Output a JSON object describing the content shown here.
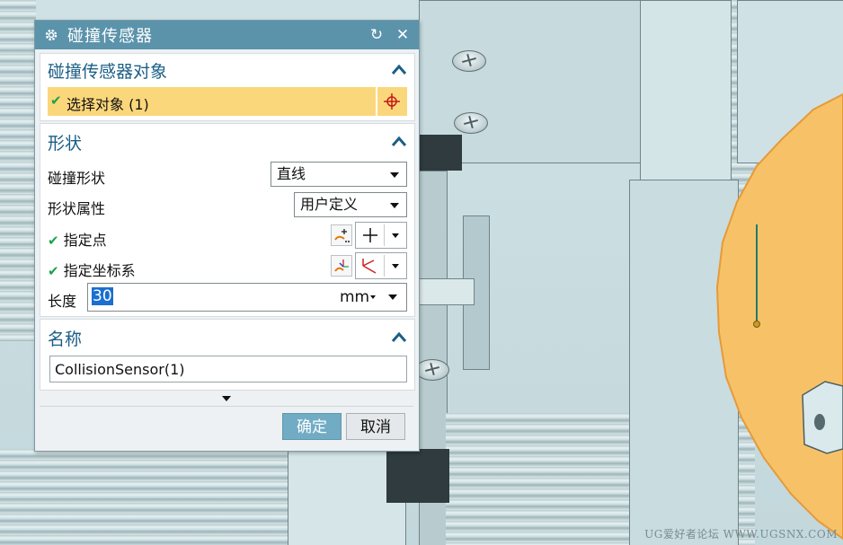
{
  "dialog": {
    "title": "碰撞传感器",
    "reset_icon": "reset-icon",
    "close_icon": "close-icon"
  },
  "object_section": {
    "title": "碰撞传感器对象",
    "select_label": "选择对象 (1)",
    "selected": true
  },
  "shape_section": {
    "title": "形状",
    "collision_shape_label": "碰撞形状",
    "collision_shape_value": "直线",
    "shape_property_label": "形状属性",
    "shape_property_value": "用户定义",
    "specify_point_label": "指定点",
    "specify_csys_label": "指定坐标系",
    "length_label": "长度",
    "length_value": "30",
    "length_unit": "mm"
  },
  "name_section": {
    "title": "名称",
    "name_value": "CollisionSensor(1)"
  },
  "buttons": {
    "ok": "确定",
    "cancel": "取消"
  },
  "watermark": "UG爱好者论坛 WWW.UGSNX.COM",
  "colors": {
    "title_bar": "#5b93ab",
    "section_title": "#1b5f86",
    "selected_row": "#fbd77b",
    "ok_button": "#71acc4",
    "disk": "#f7c267"
  }
}
